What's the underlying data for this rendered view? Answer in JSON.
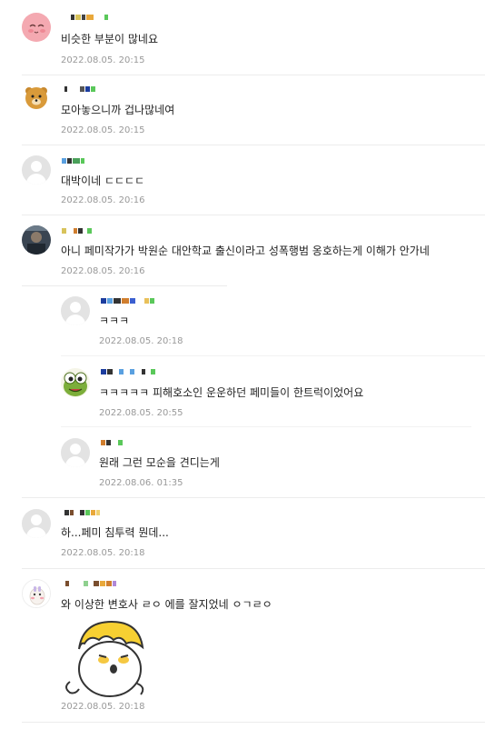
{
  "comments": [
    {
      "text": "비슷한 부분이 많네요",
      "date": "2022.08.05. 20:15",
      "avatar": "pink-character-avatar"
    },
    {
      "text": "모아놓으니까 겁나많네여",
      "date": "2022.08.05. 20:15",
      "avatar": "bear-character-avatar"
    },
    {
      "text": "대박이네 ㄷㄷㄷㄷ",
      "date": "2022.08.05. 20:16",
      "avatar": "default-avatar"
    },
    {
      "text": "아니 페미작가가 박원순 대안학교 출신이라고 성폭행범 옹호하는게 이해가 안가네",
      "date": "2022.08.05. 20:16",
      "avatar": "photo-avatar"
    },
    {
      "text": "ㅋㅋㅋ",
      "date": "2022.08.05. 20:18",
      "avatar": "default-avatar",
      "reply": true
    },
    {
      "text": "ㅋㅋㅋㅋㅋ 피해호소인 운운하던 페미들이 한트럭이었어요",
      "date": "2022.08.05. 20:55",
      "avatar": "frog-character-avatar",
      "reply": true
    },
    {
      "text": "원래 그런 모순을 견디는게",
      "date": "2022.08.06. 01:35",
      "avatar": "default-avatar",
      "reply": true
    },
    {
      "text": "하...페미 침투력 뭔데...",
      "date": "2022.08.05. 20:18",
      "avatar": "default-avatar"
    },
    {
      "text": "와 이상한 변호사 ㄹㅇ 에를 잘지었네 ㅇㄱㄹㅇ",
      "date": "2022.08.05. 20:18",
      "avatar": "rabbit-character-avatar",
      "sticker": "yellow-hair-character-sticker"
    }
  ],
  "colors": {
    "text": "#222222",
    "date": "#999999",
    "divider": "#ececec"
  }
}
